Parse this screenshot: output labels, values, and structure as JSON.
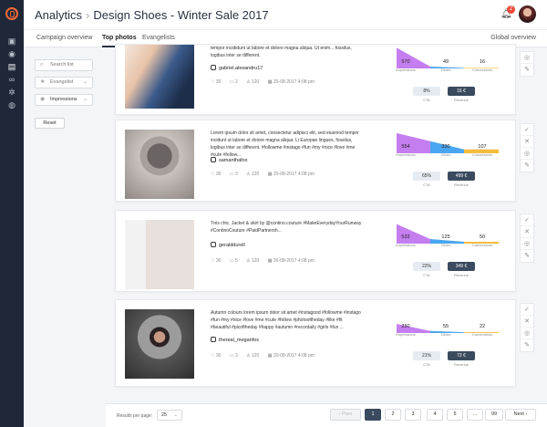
{
  "header": {
    "app": "Analytics",
    "campaign": "Design Shoes - Winter Sale 2017",
    "notification_count": "2"
  },
  "tabs": [
    "Campaign overview",
    "Top photos",
    "Evangelists"
  ],
  "tab_right": "Global overview",
  "filters": {
    "search_placeholder": "Search list",
    "evangelist": "Evangelist",
    "metric": "Impressions",
    "reset": "Reset"
  },
  "labels": {
    "impressions": "Impressions",
    "clicks": "Clicks",
    "conversions": "Conversions",
    "ctr": "CTA",
    "revenue": "Revenue"
  },
  "colors": {
    "impressions": "#c47ef0",
    "clicks": "#4aa6f0",
    "conversions": "#f5bd3c"
  },
  "posts": [
    {
      "caption": "tempor incididunt ut labore et dolore magna aliqua. Ut enim... fossilus, logibus inter se different.",
      "handle": "gabriel.alexandru17",
      "likes": "30",
      "comments": "2",
      "users": "120",
      "date": "20-08-2017 4:08 pm",
      "impressions": "570",
      "clicks": "49",
      "conversions": "16",
      "ctr": "8%",
      "revenue": "16 €"
    },
    {
      "caption": "Lorem ipsum dolor sit amet, consectetur adipisci elit, sed eiusmod tempor incidunt ut labore et dolore magna aliqua. Li Europan lingues, fossilus, logibus inter se different. #followme #instago #fun #my #nice #love #me #cute #follow...",
      "handle": "samanthafox",
      "likes": "30",
      "comments": "3",
      "users": "120",
      "date": "20-08-2017 4:08 pm",
      "impressions": "554",
      "clicks": "330",
      "conversions": "107",
      "ctr": "65%",
      "revenue": "499 €"
    },
    {
      "caption": "Trés chic. Jacket & skirt by @contino.couture #MakeEverydayYourRunway #ContinoCouture #PaidPartnersh...",
      "handle": "geralddurell",
      "likes": "30",
      "comments": "5",
      "users": "120",
      "date": "20-08-2017 4:08 pm",
      "impressions": "533",
      "clicks": "125",
      "conversions": "50",
      "ctr": "22%",
      "revenue": "349 €"
    },
    {
      "caption": "Autumn colours lorem ipsum dolor sit amet #instagood #followme #instago #fun #my #nice #love #me #cute #follow #photooftheday #like #fit #beautiful #picoftheday #happy #autumn #recordaily #girls #fun ...",
      "handle": "thereal_meganfox",
      "likes": "30",
      "comments": "3",
      "users": "120",
      "date": "20-08-2017 4:08 pm",
      "impressions": "250",
      "clicks": "55",
      "conversions": "22",
      "ctr": "21%",
      "revenue": "72 €"
    }
  ],
  "pagination": {
    "results_label": "Results per page:",
    "per_page": "25",
    "prev": "Prev",
    "pages": [
      "1",
      "2",
      "3",
      "4",
      "5",
      "...",
      "99"
    ],
    "next": "Next",
    "current": "1"
  }
}
